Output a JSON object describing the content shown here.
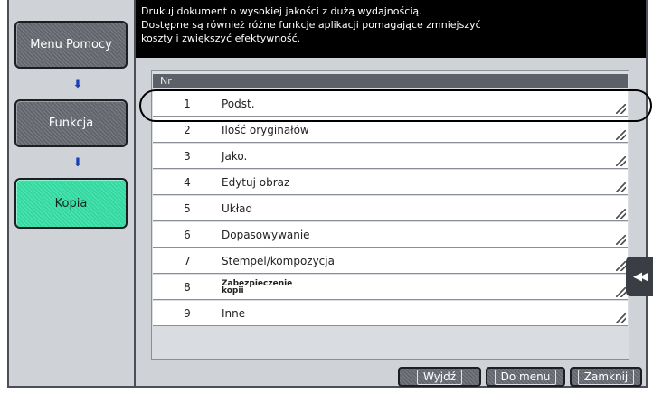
{
  "nav": {
    "items": [
      {
        "label": "Menu Pomocy"
      },
      {
        "label": "Funkcja"
      },
      {
        "label": "Kopia"
      }
    ],
    "arrow_icon": "arrow-down-icon"
  },
  "description": {
    "lines": [
      "Drukuj dokument o wysokiej jakości z dużą wydajnością.",
      "Dostępne są również różne funkcje aplikacji pomagające zmniejszyć",
      "koszty i zwiększyć efektywność."
    ]
  },
  "list": {
    "header": "Nr",
    "rows": [
      {
        "num": "1",
        "label": "Podst."
      },
      {
        "num": "2",
        "label": "Ilość oryginałów"
      },
      {
        "num": "3",
        "label": "Jako."
      },
      {
        "num": "4",
        "label": "Edytuj obraz"
      },
      {
        "num": "5",
        "label": "Układ"
      },
      {
        "num": "6",
        "label": "Dopasowywanie"
      },
      {
        "num": "7",
        "label": "Stempel/kompozycja"
      },
      {
        "num": "8",
        "label_line1": "Zabezpieczenie",
        "label_line2": "kopii"
      },
      {
        "num": "9",
        "label": "Inne"
      }
    ]
  },
  "side_tab": {
    "icon": "double-chevron-left-icon",
    "glyph": "◀◀"
  },
  "footer": {
    "exit_label": "Wyjdź",
    "menu_label": "Do menu",
    "close_label": "Zamknij"
  },
  "colors": {
    "active_nav": "#36d6a0",
    "nav_button": "#6b6f75",
    "arrow": "#1a3fb5"
  }
}
